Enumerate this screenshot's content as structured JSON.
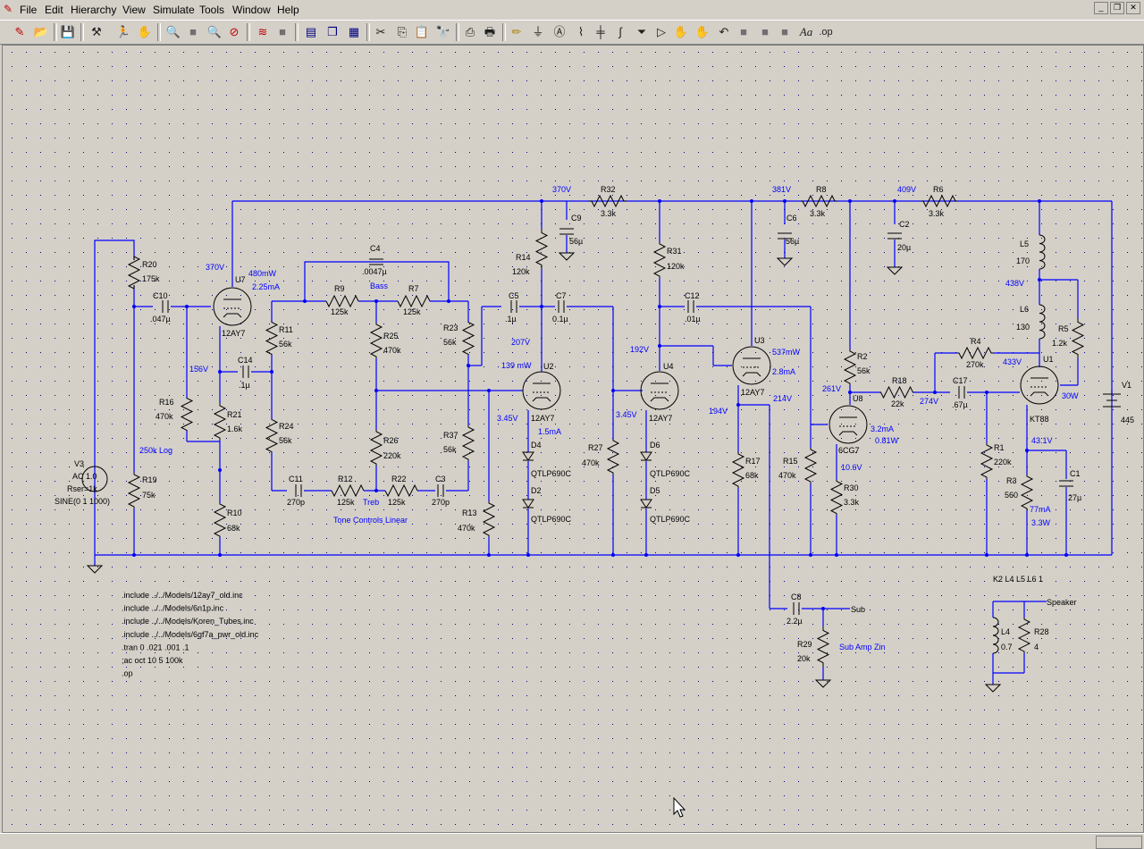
{
  "menu": [
    "File",
    "Edit",
    "Hierarchy",
    "View",
    "Simulate",
    "Tools",
    "Window",
    "Help"
  ],
  "toolbar": [
    "new-schematic",
    "open",
    "save",
    "control-panel",
    "run",
    "halt",
    "zoom-in",
    "zoom-fit",
    "zoom-out",
    "zoom-cancel",
    "plot",
    "blank",
    "tile-horizontal",
    "cascade",
    "tile",
    "cut",
    "copy",
    "paste",
    "find",
    "print-setup",
    "print",
    "draw-wire",
    "ground",
    "label-net",
    "resistor",
    "capacitor",
    "inductor",
    "diode",
    "component",
    "move",
    "drag",
    "undo",
    "redo",
    "rotate",
    "mirror",
    "text",
    "spice-directive"
  ],
  "labels": {
    "V3": "V3",
    "V3_src": "AC 1.0",
    "V3_rser": "Rser=1k",
    "V3_sine": "SINE(0 1 1000)",
    "R20": "R20",
    "R20_v": "175k",
    "C10": "C10",
    "C10_v": ".047µ",
    "R16": "R16",
    "R16_v": "470k",
    "pot1": "250k Log",
    "R19": "R19",
    "R19_v": "75k",
    "U7": "U7",
    "U7_t": "12AY7",
    "U7_v": "370V",
    "U7_p": "480mW",
    "U7_i": "2.25mA",
    "n156": "156V",
    "C14": "C14",
    "C14_v": ".1µ",
    "R21": "R21",
    "R21_v": "1.6k",
    "R10": "R10",
    "R10_v": "68k",
    "R11": "R11",
    "R11_v": "56k",
    "R24": "R24",
    "R24_v": "56k",
    "C11": "C11",
    "C11_v": "270p",
    "C4": "C4",
    "C4_v": ".0047µ",
    "R9": "R9",
    "R9_v": "125k",
    "bass": "Bass",
    "R7": "R7",
    "R7_v": "125k",
    "R25": "R25",
    "R25_v": "470k",
    "R26": "R26",
    "R26_v": "220k",
    "R12": "R12",
    "R12_v": "125k",
    "treb": "Treb",
    "R22": "R22",
    "R22_v": "125k",
    "C3": "C3",
    "C3_v": "270p",
    "tone": "Tone Controls Linear",
    "R23": "R23",
    "R23_v": "56k",
    "R37": "R37",
    "R37_v": "56k",
    "R13": "R13",
    "R13_v": "470k",
    "n370": "370V",
    "R32": "R32",
    "R32_v": "3.3k",
    "C9": "C9",
    "C9_v": "56µ",
    "R14": "R14",
    "R14_v": "120k",
    "C5": "C5",
    "C5_v": ".1µ",
    "C7": "C7",
    "C7_v": "0.1µ",
    "n207": "207V",
    "U2": "U2",
    "U2_p": "139 mW",
    "U2_t": "12AY7",
    "U2_k": "3.45V",
    "U2_i": "1.5mA",
    "D4": "D4",
    "D4_t": "QTLP690C",
    "D2": "D2",
    "D2_t": "QTLP690C",
    "R27": "R27",
    "R27_v": "470k",
    "R31": "R31",
    "R31_v": "120k",
    "C12": "C12",
    "C12_v": ".01µ",
    "n192": "192V",
    "U4": "U4",
    "U4_t": "12AY7",
    "U4_k": "3.45V",
    "D6": "D6",
    "D6_t": "QTLP690C",
    "D5": "D5",
    "D5_t": "QTLP690C",
    "n381": "381V",
    "R8": "R8",
    "R8_v": "3.3k",
    "C6": "C6",
    "C6_v": "56µ",
    "U3": "U3",
    "U3_p": "537mW",
    "U3_i": "2.8mA",
    "U3_t": "12AY7",
    "n214": "214V",
    "n194": "194V",
    "R17": "R17",
    "R17_v": "68k",
    "R15": "R15",
    "R15_v": "470k",
    "n409": "409V",
    "R6": "R6",
    "R6_v": "3.3k",
    "C2": "C2",
    "C2_v": "20µ",
    "R2": "R2",
    "R2_v": "56k",
    "n261": "261V",
    "U8": "U8",
    "U8_t": "6CG7",
    "U8_i": "3.2mA",
    "U8_p": "0.81W",
    "U8_k": "10.6V",
    "R30": "R30",
    "R30_v": "3.3k",
    "R18": "R18",
    "R18_v": "22k",
    "n274": "274V",
    "C17": "C17",
    "C17_v": ".67µ",
    "R4": "R4",
    "R4_v": "270k",
    "n433": "433V",
    "U1": "U1",
    "U1_t": "KT88",
    "U1_p": "30W",
    "L5": "L5",
    "L5_v": "170",
    "n438": "438V",
    "L6": "L6",
    "L6_v": "130",
    "R5": "R5",
    "R5_v": "1.2k",
    "V1": "V1",
    "V1_v": "445",
    "R1": "R1",
    "R1_v": "220k",
    "n43": "43.1V",
    "R3": "R3",
    "R3_v": "560",
    "R3_i": "77mA",
    "R3_p": "3.3W",
    "C1": "C1",
    "C1_v": "27µ",
    "C8": "C8",
    "C8_v": "2.2µ",
    "sub": "Sub",
    "R29": "R29",
    "R29_v": "20k",
    "subamp": "Sub Amp Zin",
    "K": "K2 L4 L5 L6 1",
    "speaker": "Speaker",
    "L4": "L4",
    "L4_v": "0.7",
    "R28": "R28",
    "R28_v": "4"
  },
  "directives": [
    ".include ../../Models/12ay7_old.inc",
    ".include ../../Models/6n1p.inc",
    ".include ../../Models/Koren_Tubes.inc",
    ".include ../../Models/6gf7a_pwr_old.inc",
    ".tran 0 .021 .001 .1",
    ";ac oct 10 5 100k",
    ".op"
  ],
  "colors": {
    "wire": "#0000ff",
    "grid": "#000080",
    "annotation": "#0000ff",
    "text": "#000000"
  }
}
